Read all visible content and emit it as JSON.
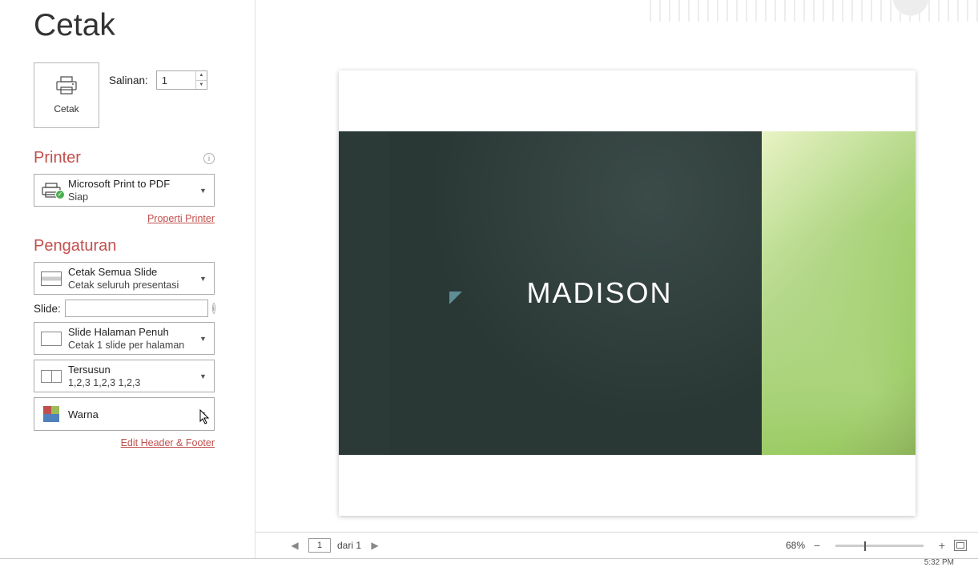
{
  "page_title": "Cetak",
  "print_button_label": "Cetak",
  "copies": {
    "label": "Salinan:",
    "value": "1"
  },
  "printer_section": {
    "heading": "Printer",
    "selected": {
      "name": "Microsoft Print to PDF",
      "status": "Siap"
    },
    "properties_link": "Properti Printer"
  },
  "settings_section": {
    "heading": "Pengaturan",
    "what_to_print": {
      "line1": "Cetak Semua Slide",
      "line2": "Cetak seluruh presentasi"
    },
    "slide_range": {
      "label": "Slide:",
      "value": ""
    },
    "layout": {
      "line1": "Slide Halaman Penuh",
      "line2": "Cetak 1 slide per halaman"
    },
    "collation": {
      "line1": "Tersusun",
      "line2": "1,2,3    1,2,3    1,2,3"
    },
    "color": {
      "line1": "Warna"
    },
    "edit_header_footer_link": "Edit Header & Footer"
  },
  "preview": {
    "slide_title": "MADISON",
    "current_page": "1",
    "page_of_text": "dari 1",
    "zoom_percent": "68%"
  },
  "taskbar": {
    "time": "5:32 PM"
  }
}
